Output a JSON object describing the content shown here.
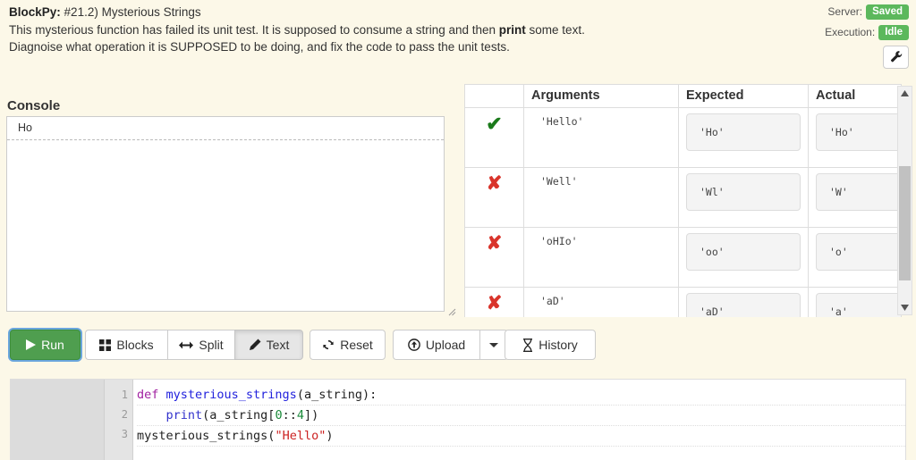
{
  "header": {
    "app_name": "BlockPy:",
    "problem_id": "#21.2) Mysterious Strings",
    "instruction_line_1a": "This mysterious function has failed its unit test. It is supposed to consume a string and then ",
    "instruction_line_1b": "print",
    "instruction_line_1c": " some text.",
    "instruction_line_2": "Diagnoise what operation it is SUPPOSED to be doing, and fix the code to pass the unit tests.",
    "server_label": "Server:",
    "server_status": "Saved",
    "execution_label": "Execution:",
    "execution_status": "Idle",
    "settings_icon": "wrench-icon",
    "badge_color": "#5cb85c"
  },
  "console": {
    "title": "Console",
    "lines": [
      "Ho"
    ]
  },
  "unit_table": {
    "columns": [
      "",
      "Arguments",
      "Expected",
      "Actual"
    ],
    "rows": [
      {
        "status": "pass",
        "status_glyph": "✔",
        "arguments": "'Hello'",
        "expected": "'Ho'",
        "actual": "'Ho'"
      },
      {
        "status": "fail",
        "status_glyph": "✘",
        "arguments": "'Well'",
        "expected": "'Wl'",
        "actual": "'W'"
      },
      {
        "status": "fail",
        "status_glyph": "✘",
        "arguments": "'oHIo'",
        "expected": "'oo'",
        "actual": "'o'"
      },
      {
        "status": "fail",
        "status_glyph": "✘",
        "arguments": "'aD'",
        "expected": "'aD'",
        "actual": "'a'"
      }
    ]
  },
  "scrollbar": {
    "up_icon": "scroll-up-arrow-icon",
    "down_icon": "scroll-down-arrow-icon"
  },
  "toolbar": {
    "run": {
      "label": "Run",
      "icon": "play-icon"
    },
    "blocks": {
      "label": "Blocks",
      "icon": "grid-blocks-icon"
    },
    "split": {
      "label": "Split",
      "icon": "left-right-arrow-icon"
    },
    "text": {
      "label": "Text",
      "icon": "pencil-icon",
      "active": true
    },
    "reset": {
      "label": "Reset",
      "icon": "refresh-icon"
    },
    "upload": {
      "label": "Upload",
      "icon": "upload-circle-icon"
    },
    "upload_caret": {
      "icon": "caret-down-icon"
    },
    "history": {
      "label": "History",
      "icon": "hourglass-icon"
    }
  },
  "editor": {
    "line_numbers": [
      "1",
      "2",
      "3"
    ],
    "lines": [
      [
        {
          "t": "def ",
          "c": "kw"
        },
        {
          "t": "mysterious_strings",
          "c": "def"
        },
        {
          "t": "(a_string):",
          "c": "plain"
        }
      ],
      [
        {
          "t": "    ",
          "c": "plain"
        },
        {
          "t": "print",
          "c": "fn"
        },
        {
          "t": "(a_string[",
          "c": "plain"
        },
        {
          "t": "0",
          "c": "num"
        },
        {
          "t": "::",
          "c": "plain"
        },
        {
          "t": "4",
          "c": "num"
        },
        {
          "t": "])",
          "c": "plain"
        }
      ],
      [
        {
          "t": "mysterious_strings(",
          "c": "plain"
        },
        {
          "t": "\"Hello\"",
          "c": "str"
        },
        {
          "t": ")",
          "c": "plain"
        }
      ]
    ]
  }
}
